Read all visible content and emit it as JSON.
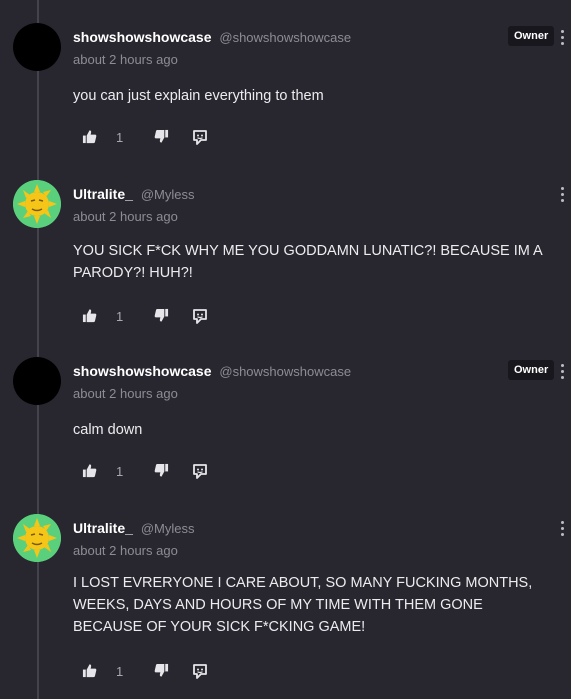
{
  "comments": [
    {
      "name": "showshowshowcase",
      "handle": "@showshowshowcase",
      "time": "about 2 hours ago",
      "text": "you can just explain everything to them",
      "badge": "Owner",
      "likes": "1",
      "avatar": "black"
    },
    {
      "name": "Ultralite_",
      "handle": "@Myless",
      "time": "about 2 hours ago",
      "text": "YOU SICK F*CK WHY ME YOU GODDAMN LUNATIC?! BECAUSE IM A PARODY?! HUH?!",
      "badge": "",
      "likes": "1",
      "avatar": "sun"
    },
    {
      "name": "showshowshowcase",
      "handle": "@showshowshowcase",
      "time": "about 2 hours ago",
      "text": "calm down",
      "badge": "Owner",
      "likes": "1",
      "avatar": "black"
    },
    {
      "name": "Ultralite_",
      "handle": "@Myless",
      "time": "about 2 hours ago",
      "text": "I LOST EVRERYONE I CARE ABOUT, SO MANY FUCKING MONTHS, WEEKS, DAYS AND HOURS OF MY TIME WITH THEM GONE BECAUSE OF YOUR SICK F*CKING GAME!",
      "badge": "",
      "likes": "1",
      "avatar": "sun"
    }
  ],
  "icons": {
    "like": "thumbs-up-icon",
    "dislike": "thumbs-down-icon",
    "reply": "reply-icon",
    "menu": "more-vertical-icon"
  },
  "colors": {
    "background": "#28272f",
    "badge_bg": "#18171d",
    "avatar_green": "#5bd07c",
    "sun_yellow": "#f5c518"
  }
}
